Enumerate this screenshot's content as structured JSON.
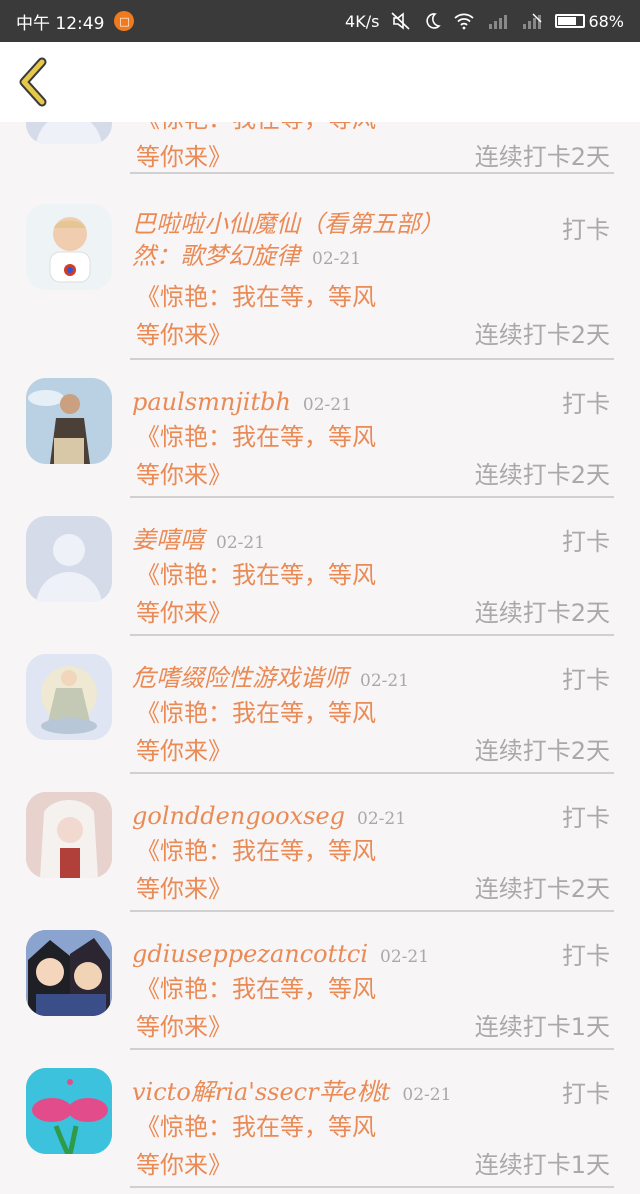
{
  "status_bar": {
    "left_text": "中午 12:49",
    "notify_glyph": "□",
    "net_speed": "4K/s",
    "battery_percent": "68%",
    "battery_level": 0.68,
    "icons": [
      "mute-icon",
      "moon-icon",
      "wifi-icon",
      "signal-icon",
      "signal-icon",
      "battery-icon"
    ]
  },
  "header": {
    "back_icon": "chevron-left-icon"
  },
  "partial_item": {
    "msg_line1": "《惊艳：我在等，等风",
    "msg_line2": "等你来》",
    "streak": "连续打卡2天"
  },
  "items": [
    {
      "name": "巴啦啦小仙魔仙（看第五部）然：歌梦幻旋律",
      "date": "02-21",
      "action": "打卡",
      "msg_line1": "《惊艳：我在等，等风",
      "msg_line2": "等你来》",
      "streak": "连续打卡2天"
    },
    {
      "name": "paulsmnjitbh",
      "date": "02-21",
      "action": "打卡",
      "msg_line1": "《惊艳：我在等，等风",
      "msg_line2": "等你来》",
      "streak": "连续打卡2天"
    },
    {
      "name": "姜嘻嘻",
      "date": "02-21",
      "action": "打卡",
      "msg_line1": "《惊艳：我在等，等风",
      "msg_line2": "等你来》",
      "streak": "连续打卡2天"
    },
    {
      "name": "危嗜缀险性游戏谐师",
      "date": "02-21",
      "action": "打卡",
      "msg_line1": "《惊艳：我在等，等风",
      "msg_line2": "等你来》",
      "streak": "连续打卡2天"
    },
    {
      "name": "golnddengooxseg",
      "date": "02-21",
      "action": "打卡",
      "msg_line1": "《惊艳：我在等，等风",
      "msg_line2": "等你来》",
      "streak": "连续打卡2天"
    },
    {
      "name": "gdiuseppezancottci",
      "date": "02-21",
      "action": "打卡",
      "msg_line1": "《惊艳：我在等，等风",
      "msg_line2": "等你来》",
      "streak": "连续打卡1天"
    },
    {
      "name": "victo解ria'ssecr苹e桃t",
      "date": "02-21",
      "action": "打卡",
      "msg_line1": "《惊艳：我在等，等风",
      "msg_line2": "等你来》",
      "streak": "连续打卡1天"
    }
  ],
  "colors": {
    "accent": "#ea8a55",
    "muted": "#a9a9a9",
    "back": "#e6c84a"
  }
}
